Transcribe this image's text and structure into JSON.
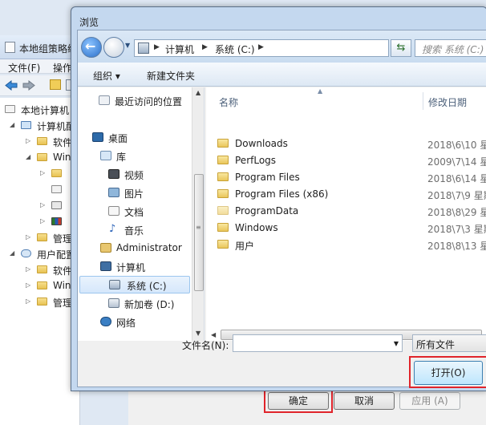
{
  "bg_window": {
    "title": "本地组策略编",
    "menu": [
      "文件(F)",
      "操作"
    ],
    "tree": [
      {
        "label": "本地计算机",
        "level": 0
      },
      {
        "label": "计算机配",
        "level": 1
      },
      {
        "label": "软件",
        "level": 2
      },
      {
        "label": "Win",
        "level": 2
      },
      {
        "label": "管理",
        "level": 2
      },
      {
        "label": "用户配置",
        "level": 1
      },
      {
        "label": "软件",
        "level": 2
      },
      {
        "label": "Win",
        "level": 2
      },
      {
        "label": "管理",
        "level": 2
      }
    ],
    "buttons": {
      "ok": "确定",
      "cancel": "取消",
      "apply": "应用 (A)"
    }
  },
  "dialog": {
    "title": "浏览",
    "address": {
      "crumbs": [
        "计算机",
        "系统 (C:)"
      ]
    },
    "search_placeholder": "搜索 系统 (C:)",
    "commands": {
      "organize": "组织 ▾",
      "new_folder": "新建文件夹"
    },
    "nav": [
      {
        "label": "最近访问的位置",
        "icon": "recent-places-icon"
      },
      {
        "label": "桌面",
        "icon": "desktop-icon"
      },
      {
        "label": "库",
        "icon": "library-icon"
      },
      {
        "label": "视频",
        "icon": "video-icon"
      },
      {
        "label": "图片",
        "icon": "pictures-icon"
      },
      {
        "label": "文档",
        "icon": "documents-icon"
      },
      {
        "label": "音乐",
        "icon": "music-icon"
      },
      {
        "label": "Administrator",
        "icon": "user-icon"
      },
      {
        "label": "计算机",
        "icon": "computer-icon"
      },
      {
        "label": "系统 (C:)",
        "icon": "drive-icon",
        "selected": true
      },
      {
        "label": "新加卷 (D:)",
        "icon": "drive-icon"
      },
      {
        "label": "网络",
        "icon": "network-icon"
      }
    ],
    "columns": {
      "name": "名称",
      "modified": "修改日期"
    },
    "files": [
      {
        "name": "Downloads",
        "date": "2018\\6\\10 星"
      },
      {
        "name": "PerfLogs",
        "date": "2009\\7\\14 星"
      },
      {
        "name": "Program Files",
        "date": "2018\\6\\14 星"
      },
      {
        "name": "Program Files (x86)",
        "date": "2018\\7\\9 星期"
      },
      {
        "name": "ProgramData",
        "date": "2018\\8\\29 星"
      },
      {
        "name": "Windows",
        "date": "2018\\7\\3 星期"
      },
      {
        "name": "用户",
        "date": "2018\\8\\13 星"
      }
    ],
    "filename_label": "文件名(N):",
    "filename_value": "",
    "filetype": "所有文件",
    "open_button": "打开(O)"
  },
  "colors": {
    "highlight": "#e0242b",
    "accent": "#2a6fc9"
  }
}
